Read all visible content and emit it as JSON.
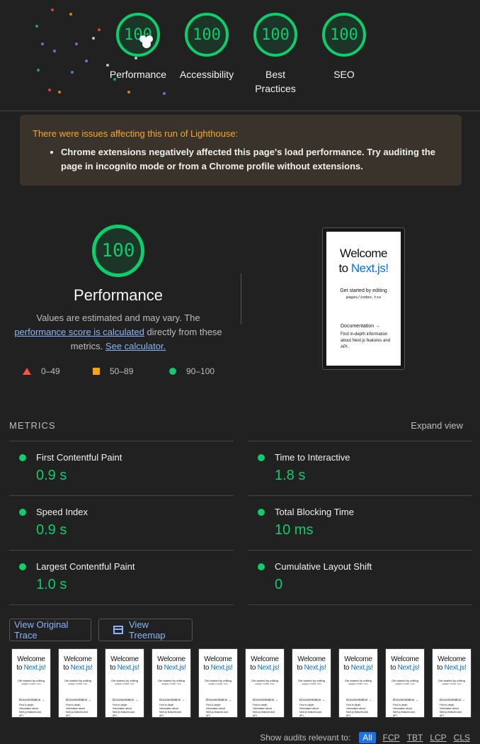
{
  "gauges": [
    {
      "label": "Performance",
      "score": "100"
    },
    {
      "label": "Accessibility",
      "score": "100"
    },
    {
      "label": "Best Practices",
      "score": "100"
    },
    {
      "label": "SEO",
      "score": "100"
    }
  ],
  "warning": {
    "title": "There were issues affecting this run of Lighthouse:",
    "item": "Chrome extensions negatively affected this page's load performance. Try auditing the page in incognito mode or from a Chrome profile without extensions."
  },
  "performance": {
    "score": "100",
    "title": "Performance",
    "desc_before": "Values are estimated and may vary. The ",
    "desc_link1": "performance score is calculated",
    "desc_middle": " directly from these metrics. ",
    "desc_link2": "See calculator."
  },
  "legend": [
    {
      "range": "0–49",
      "color": "#ff4e42"
    },
    {
      "range": "50–89",
      "color": "#ffa400"
    },
    {
      "range": "90–100",
      "color": "#0cce6b"
    }
  ],
  "final_screenshot": {
    "line1": "Welcome",
    "line2_prefix": "to ",
    "line2_brand": "Next.js!",
    "get_started": "Get started by editing",
    "code": "pages/index.tsx",
    "doc_link": "Documentation →",
    "doc_desc": "Find in-depth information about Next.js features and API."
  },
  "metrics": {
    "heading": "METRICS",
    "expand": "Expand view",
    "items": [
      {
        "name": "First Contentful Paint",
        "value": "0.9 s"
      },
      {
        "name": "Time to Interactive",
        "value": "1.8 s"
      },
      {
        "name": "Speed Index",
        "value": "0.9 s"
      },
      {
        "name": "Total Blocking Time",
        "value": "10 ms"
      },
      {
        "name": "Largest Contentful Paint",
        "value": "1.0 s"
      },
      {
        "name": "Cumulative Layout Shift",
        "value": "0"
      }
    ]
  },
  "buttons": {
    "trace": "View Original Trace",
    "treemap": "View Treemap"
  },
  "filmstrip": {
    "line1": "Welcome",
    "line2_prefix": "to ",
    "line2_brand": "Next.js!",
    "get_started": "Get started by editing",
    "code": "pages/index.tsx",
    "doc_link": "Documentation →",
    "doc_desc": "Find in-depth information about Next.js features and API."
  },
  "filter": {
    "label": "Show audits relevant to:",
    "options": [
      "All",
      "FCP",
      "TBT",
      "LCP",
      "CLS"
    ],
    "active": "All"
  },
  "colors": {
    "pass": "#0cce6b",
    "link": "#8ab4f8",
    "warning": "#f9a825"
  }
}
